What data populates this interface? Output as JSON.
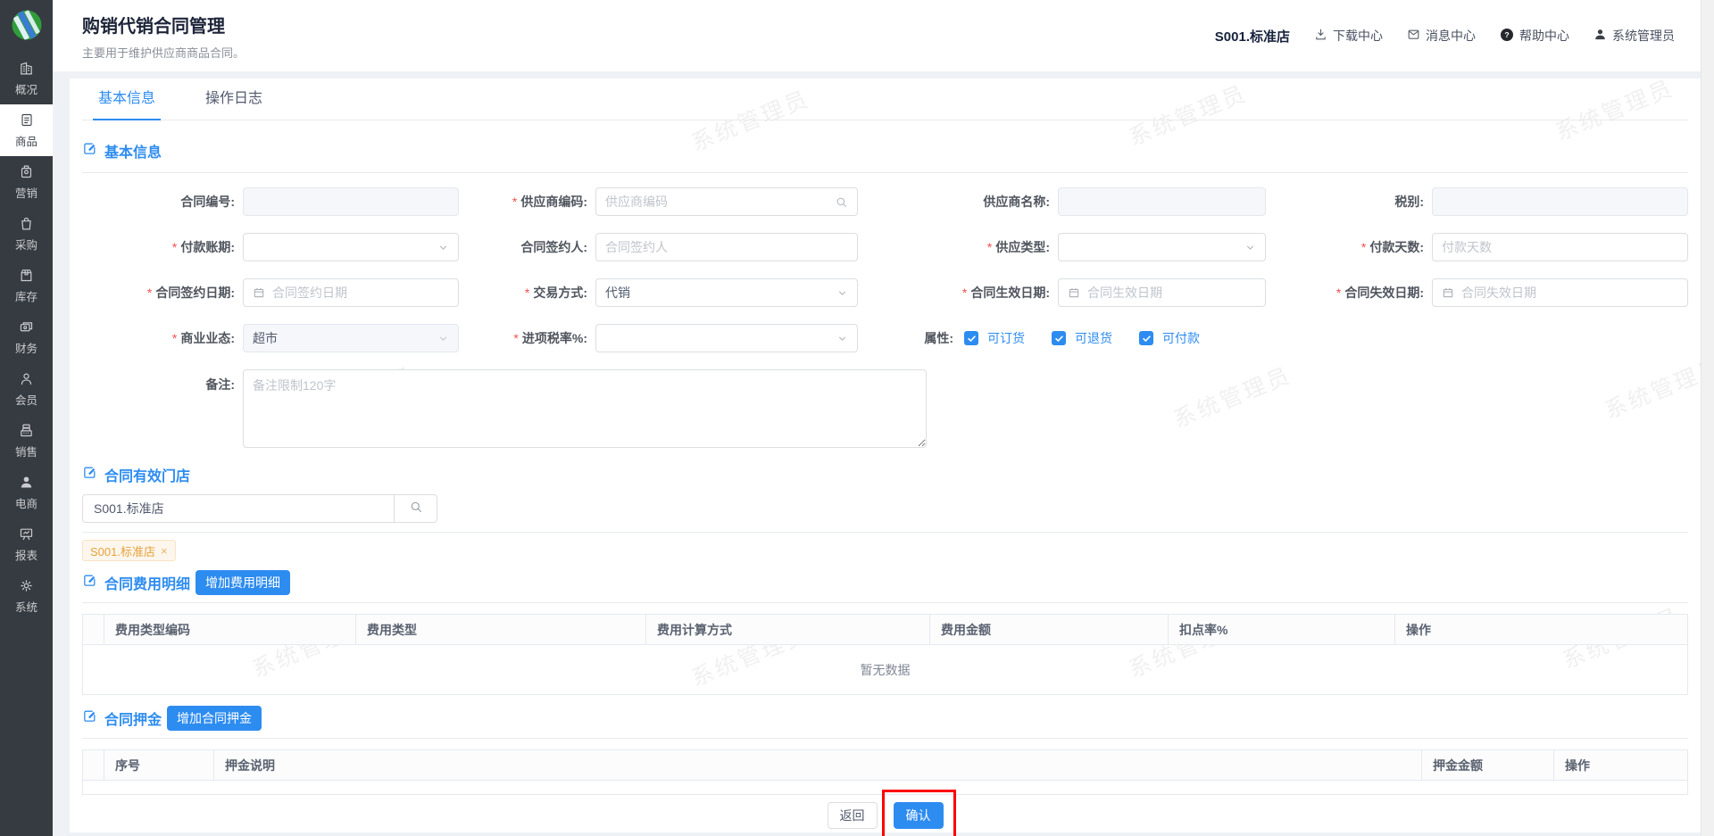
{
  "app": {
    "title": "购销代销合同管理",
    "subtitle": "主要用于维护供应商商品合同。"
  },
  "topnav": {
    "store": "S001.标准店",
    "items": [
      {
        "label": "下载中心",
        "icon": "download-icon"
      },
      {
        "label": "消息中心",
        "icon": "mail-icon"
      },
      {
        "label": "帮助中心",
        "icon": "help-icon"
      },
      {
        "label": "系统管理员",
        "icon": "user-icon"
      }
    ]
  },
  "sidebar": {
    "items": [
      {
        "label": "概况",
        "icon": "building-icon"
      },
      {
        "label": "商品",
        "icon": "document-icon",
        "active": true
      },
      {
        "label": "营销",
        "icon": "badge-icon"
      },
      {
        "label": "采购",
        "icon": "shopping-bag-icon"
      },
      {
        "label": "库存",
        "icon": "box-icon"
      },
      {
        "label": "财务",
        "icon": "money-icon"
      },
      {
        "label": "会员",
        "icon": "person-icon"
      },
      {
        "label": "销售",
        "icon": "register-icon"
      },
      {
        "label": "电商",
        "icon": "person-filled-icon"
      },
      {
        "label": "报表",
        "icon": "board-icon"
      },
      {
        "label": "系统",
        "icon": "gear-icon"
      }
    ]
  },
  "tabs": [
    {
      "label": "基本信息",
      "active": true
    },
    {
      "label": "操作日志",
      "active": false
    }
  ],
  "watermark": "系统管理员",
  "form": {
    "section_title": "基本信息",
    "contract_no": {
      "label": "合同编号:",
      "value": "",
      "disabled": true
    },
    "supplier_code": {
      "label": "供应商编码:",
      "required": true,
      "placeholder": "供应商编码"
    },
    "supplier_name": {
      "label": "供应商名称:",
      "value": "",
      "disabled": true
    },
    "tax_type": {
      "label": "税别:",
      "value": "",
      "disabled": true
    },
    "payment_period": {
      "label": "付款账期:",
      "required": true,
      "value": ""
    },
    "signer": {
      "label": "合同签约人:",
      "placeholder": "合同签约人"
    },
    "supply_type": {
      "label": "供应类型:",
      "required": true,
      "value": ""
    },
    "payment_days": {
      "label": "付款天数:",
      "required": true,
      "placeholder": "付款天数"
    },
    "sign_date": {
      "label": "合同签约日期:",
      "required": true,
      "placeholder": "合同签约日期"
    },
    "trade_mode": {
      "label": "交易方式:",
      "required": true,
      "value": "代销"
    },
    "effective_date": {
      "label": "合同生效日期:",
      "required": true,
      "placeholder": "合同生效日期"
    },
    "expiry_date": {
      "label": "合同失效日期:",
      "required": true,
      "placeholder": "合同失效日期"
    },
    "business_format": {
      "label": "商业业态:",
      "required": true,
      "value": "超市",
      "disabled": true
    },
    "input_tax_rate": {
      "label": "进项税率%:",
      "required": true,
      "value": ""
    },
    "attrs": {
      "label": "属性:",
      "options": [
        {
          "label": "可订货",
          "checked": true
        },
        {
          "label": "可退货",
          "checked": true
        },
        {
          "label": "可付款",
          "checked": true
        }
      ]
    },
    "remark": {
      "label": "备注:",
      "placeholder": "备注限制120字"
    }
  },
  "stores": {
    "section_title": "合同有效门店",
    "search_value": "S001.标准店",
    "tag": "S001.标准店",
    "tag_close": "×"
  },
  "fees": {
    "section_title": "合同费用明细",
    "add_button": "增加费用明细",
    "headers": [
      "费用类型编码",
      "费用类型",
      "费用计算方式",
      "费用金额",
      "扣点率%",
      "操作"
    ],
    "empty_text": "暂无数据"
  },
  "deposit": {
    "section_title": "合同押金",
    "add_button": "增加合同押金",
    "headers": [
      "序号",
      "押金说明",
      "押金金额",
      "操作"
    ]
  },
  "footer": {
    "back": "返回",
    "confirm": "确认"
  },
  "colors": {
    "primary": "#2d8cf0",
    "sidebar": "#363b41",
    "required_star": "#f25050",
    "tag_text": "#e6a23c",
    "annotation": "#fd0000"
  }
}
